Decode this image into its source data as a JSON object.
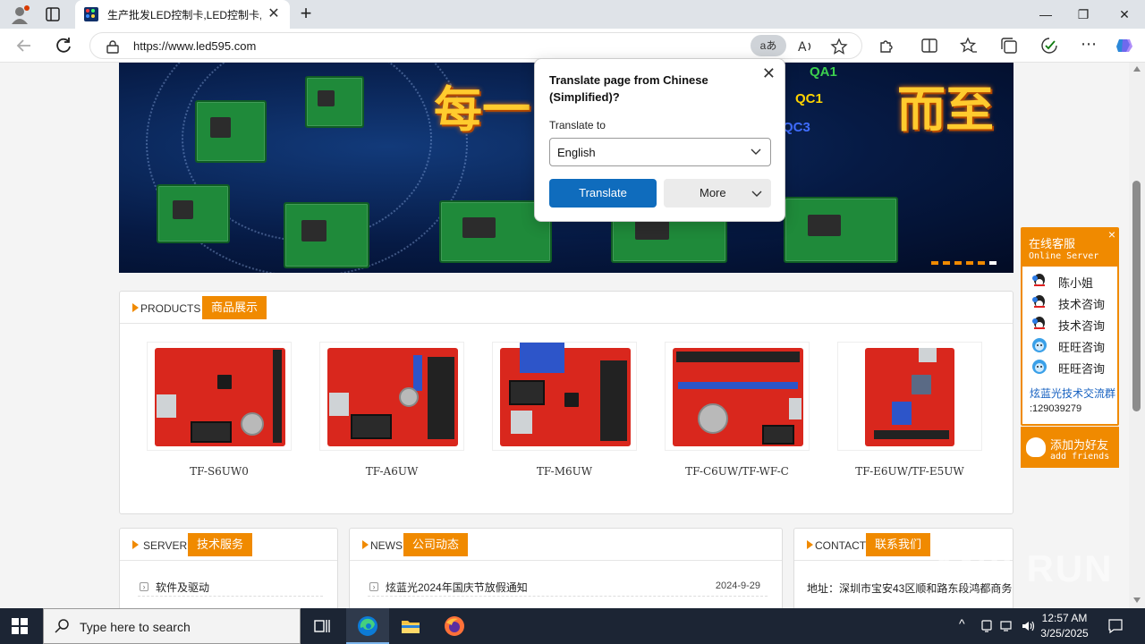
{
  "browser": {
    "tab_title": "生产批发LED控制卡,LED控制卡,G",
    "url": "https://www.led595.com",
    "translate_indicator": "aあ"
  },
  "translate_popup": {
    "title": "Translate page from Chinese (Simplified)?",
    "to_label": "Translate to",
    "language": "English",
    "translate_button": "Translate",
    "more_button": "More"
  },
  "banner": {
    "text_left": "每一",
    "text_right": "而至",
    "labels": [
      "QA1",
      "QC1",
      "QC3"
    ]
  },
  "products": {
    "en": "PRODUCTS",
    "cn": "商品展示",
    "items": [
      {
        "name": "TF-S6UW0"
      },
      {
        "name": "TF-A6UW"
      },
      {
        "name": "TF-M6UW"
      },
      {
        "name": "TF-C6UW/TF-WF-C"
      },
      {
        "name": "TF-E6UW/TF-E5UW"
      }
    ]
  },
  "server": {
    "en": "SERVER",
    "cn": "技术服务",
    "rows": [
      {
        "text": "软件及驱动"
      }
    ]
  },
  "news": {
    "en": "NEWS",
    "cn": "公司动态",
    "rows": [
      {
        "text": "炫蓝光2024年国庆节放假通知",
        "date": "2024-9-29"
      }
    ]
  },
  "contact": {
    "en": "CONTACT",
    "cn": "联系我们",
    "address": "地址：深圳市宝安43区顺和路东段鸿都商务"
  },
  "online_service": {
    "title": "在线客服",
    "subtitle": "Online Server",
    "close": "×",
    "items": [
      {
        "label": "陈小姐",
        "icon": "qq-icon"
      },
      {
        "label": "技术咨询",
        "icon": "qq-icon"
      },
      {
        "label": "技术咨询",
        "icon": "qq-icon"
      },
      {
        "label": "旺旺咨询",
        "icon": "wangwang-icon"
      },
      {
        "label": "旺旺咨询",
        "icon": "wangwang-icon"
      }
    ],
    "group_label": "炫蓝光技术交流群",
    "group_number": ":129039279",
    "add_friend": "添加为好友",
    "add_friend_sub": "add friends"
  },
  "watermark": "ANY RUN",
  "taskbar": {
    "search_placeholder": "Type here to search",
    "time": "12:57 AM",
    "date": "3/25/2025"
  },
  "colors": {
    "accent": "#f08a00",
    "edge_blue": "#0f6cbd",
    "taskbar": "#1c2534"
  }
}
